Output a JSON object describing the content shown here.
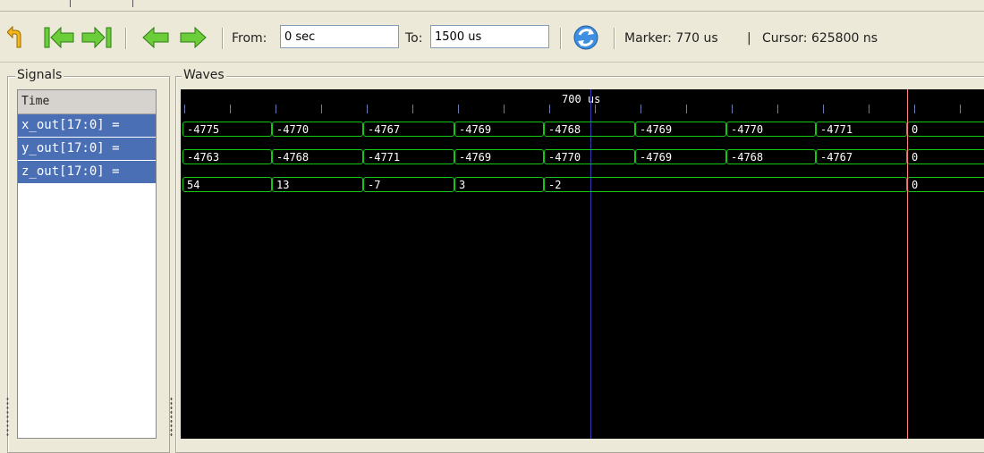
{
  "toolbar": {
    "from_label": "From:",
    "from_value": "0 sec",
    "to_label": "To:",
    "to_value": "1500 us",
    "marker_text": "Marker: 770 us",
    "separator": "|",
    "cursor_text": "Cursor: 625800 ns",
    "icons": [
      "undo-arrow-icon",
      "jump-to-start-icon",
      "jump-to-end-icon",
      "scroll-left-icon",
      "scroll-right-icon",
      "reload-icon"
    ]
  },
  "panels": {
    "signals_title": "Signals",
    "waves_title": "Waves"
  },
  "signals": {
    "time_header": "Time",
    "items": [
      {
        "label": "x_out[17:0] ="
      },
      {
        "label": "y_out[17:0] ="
      },
      {
        "label": "z_out[17:0] ="
      }
    ]
  },
  "waves": {
    "ruler_label": "700 us",
    "rows": [
      {
        "name": "x_out",
        "values": [
          "-4775",
          "-4770",
          "-4767",
          "-4769",
          "-4768",
          "-4769",
          "-4770",
          "-4771",
          "0"
        ]
      },
      {
        "name": "y_out",
        "values": [
          "-4763",
          "-4768",
          "-4771",
          "-4769",
          "-4770",
          "-4769",
          "-4768",
          "-4767",
          "0"
        ]
      },
      {
        "name": "z_out",
        "values": [
          "54",
          "13",
          "-7",
          "3",
          "-2",
          "0"
        ]
      }
    ]
  },
  "colors": {
    "wave": "#14c814",
    "selection": "#4a6fb5",
    "marker_line": "#ff8080",
    "cursor_line": "#3a3ab0",
    "wave_background": "#000000"
  }
}
